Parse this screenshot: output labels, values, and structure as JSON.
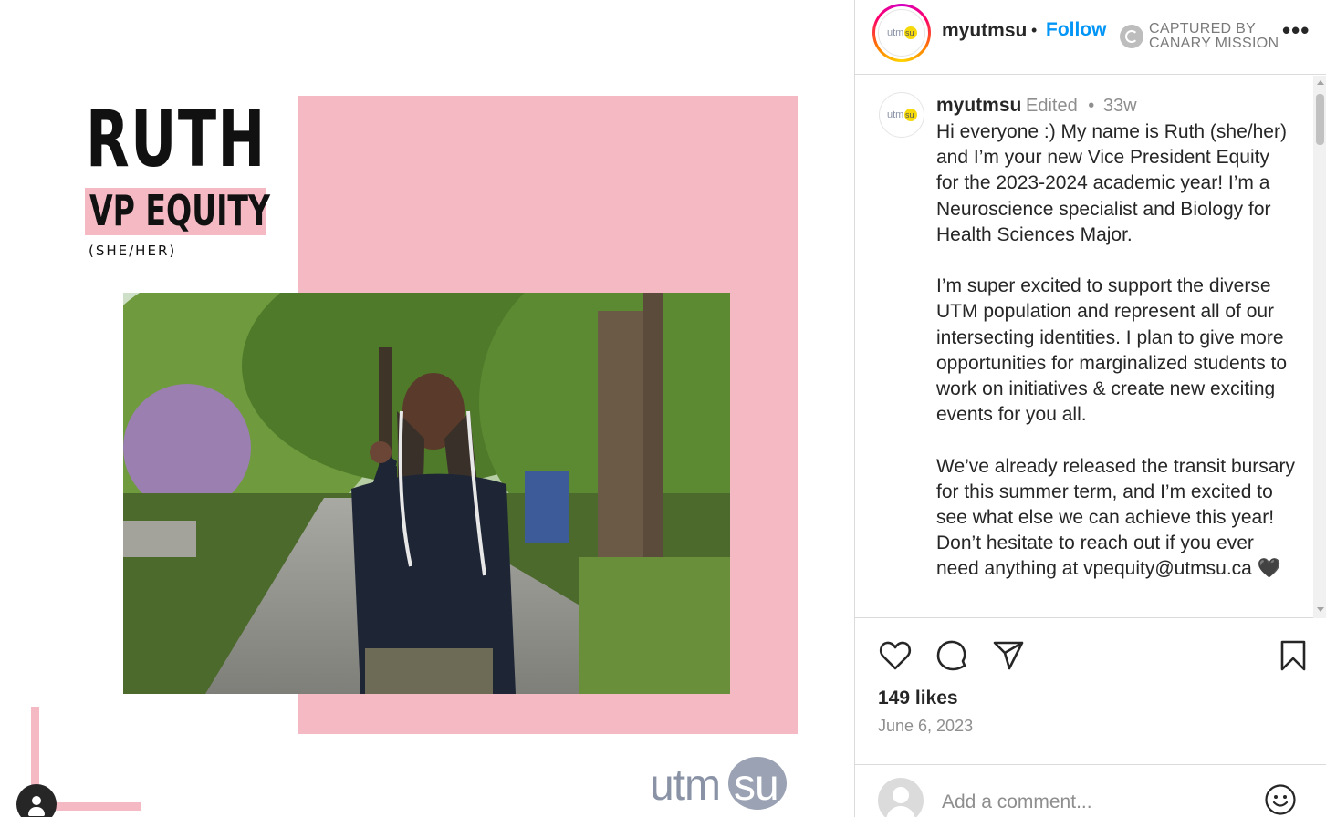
{
  "post_image": {
    "name": "RUTH",
    "role": "VP EQUITY",
    "pronouns": "(SHE/HER)",
    "brand_logo": {
      "left": "utm",
      "right": "su"
    }
  },
  "header": {
    "username": "myutmsu",
    "separator": "•",
    "follow_label": "Follow",
    "watermark_line1": "CAPTURED BY",
    "watermark_line2": "CANARY MISSION",
    "avatar_logo": {
      "left": "utm",
      "right": "su"
    }
  },
  "caption": {
    "username": "myutmsu",
    "edited_label": "Edited",
    "separator": "•",
    "time_ago": "33w",
    "text": "Hi everyone :) My name is Ruth (she/her) and I’m your new Vice President Equity for the 2023-2024 academic year! I’m a Neuroscience specialist and Biology for Health Sciences Major.\n\nI’m super excited to support the diverse UTM population and represent all of our intersecting identities. I plan to give more opportunities for marginalized students to work on initiatives & create new exciting events for you all.\n\nWe’ve already released the transit bursary for this summer term, and I’m excited to see what else we can achieve this year! Don’t hesitate to reach out if you ever need anything at vpequity@utmsu.ca 🖤"
  },
  "actions": {
    "icons": [
      "heart-icon",
      "comment-icon",
      "share-icon",
      "bookmark-icon"
    ]
  },
  "likes_label": "149 likes",
  "date": "June 6, 2023",
  "comment": {
    "placeholder": "Add a comment..."
  },
  "colors": {
    "pink": "#f4b9c3",
    "follow_blue": "#0095f6",
    "text": "#262626",
    "secondary_text": "#8e8e8e"
  }
}
